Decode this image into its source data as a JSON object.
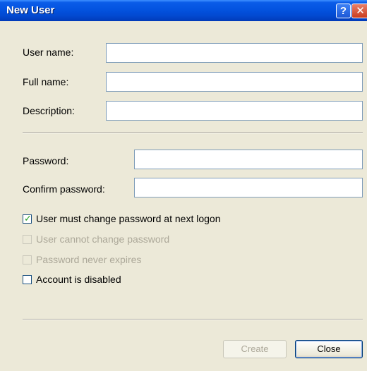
{
  "window": {
    "title": "New User"
  },
  "titlebar": {
    "help_glyph": "?",
    "close_glyph": "✕"
  },
  "fields": {
    "user_name": {
      "label": "User name:",
      "value": ""
    },
    "full_name": {
      "label": "Full name:",
      "value": ""
    },
    "description": {
      "label": "Description:",
      "value": ""
    },
    "password": {
      "label": "Password:",
      "value": ""
    },
    "confirm_password": {
      "label": "Confirm password:",
      "value": ""
    }
  },
  "options": {
    "must_change": {
      "label": "User must change password at next logon",
      "checked": true,
      "enabled": true
    },
    "cannot_change": {
      "label": "User cannot change password",
      "checked": false,
      "enabled": false
    },
    "never_expires": {
      "label": "Password never expires",
      "checked": false,
      "enabled": false
    },
    "disabled": {
      "label": "Account is disabled",
      "checked": false,
      "enabled": true
    }
  },
  "buttons": {
    "create": "Create",
    "close": "Close"
  },
  "icons": {
    "check": "check-icon"
  }
}
